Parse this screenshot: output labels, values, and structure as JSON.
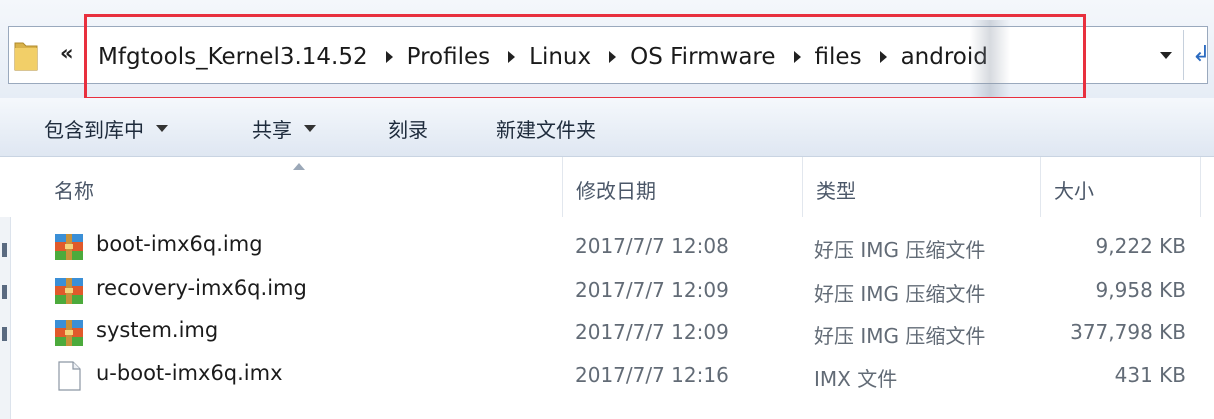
{
  "address_bar": {
    "overflow_chevron": "«",
    "crumbs": [
      "Mfgtools_Kernel3.14.52",
      "Profiles",
      "Linux",
      "OS Firmware",
      "files",
      "android"
    ],
    "highlight_color": "#e8303e"
  },
  "toolbar": {
    "include_in_library": "包含到库中",
    "share": "共享",
    "burn": "刻录",
    "new_folder": "新建文件夹"
  },
  "columns": {
    "name": "名称",
    "date_modified": "修改日期",
    "type": "类型",
    "size": "大小"
  },
  "files": [
    {
      "name": "boot-imx6q.img",
      "date": "2017/7/7 12:08",
      "type": "好压 IMG 压缩文件",
      "size": "9,222 KB",
      "icon": "archive-icon"
    },
    {
      "name": "recovery-imx6q.img",
      "date": "2017/7/7 12:09",
      "type": "好压 IMG 压缩文件",
      "size": "9,958 KB",
      "icon": "archive-icon"
    },
    {
      "name": "system.img",
      "date": "2017/7/7 12:09",
      "type": "好压 IMG 压缩文件",
      "size": "377,798 KB",
      "icon": "archive-icon"
    },
    {
      "name": "u-boot-imx6q.imx",
      "date": "2017/7/7 12:16",
      "type": "IMX 文件",
      "size": "431 KB",
      "icon": "blank-file-icon"
    }
  ]
}
